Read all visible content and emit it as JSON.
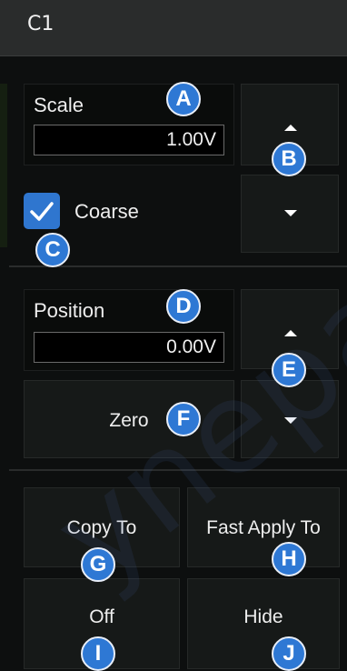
{
  "header": {
    "title": "C1"
  },
  "scale": {
    "label": "Scale",
    "value": "1.00V"
  },
  "coarse": {
    "label": "Coarse",
    "checked": true
  },
  "position": {
    "label": "Position",
    "value": "0.00V"
  },
  "buttons": {
    "zero": "Zero",
    "copy_to": "Copy To",
    "fast_apply_to": "Fast Apply To",
    "off": "Off",
    "hide": "Hide"
  },
  "badges": {
    "a": "A",
    "b": "B",
    "c": "C",
    "d": "D",
    "e": "E",
    "f": "F",
    "g": "G",
    "h": "H",
    "i": "I",
    "j": "J"
  },
  "icons": {
    "scale_up": "triangle-up-icon",
    "scale_down": "triangle-down-icon",
    "position_up": "triangle-up-icon",
    "position_down": "triangle-down-icon",
    "coarse_check": "checkmark-icon"
  },
  "watermark": "yneparuc",
  "colors": {
    "accent": "#2e78d4",
    "background": "#0d0f0f",
    "header": "#2a2c2c"
  }
}
